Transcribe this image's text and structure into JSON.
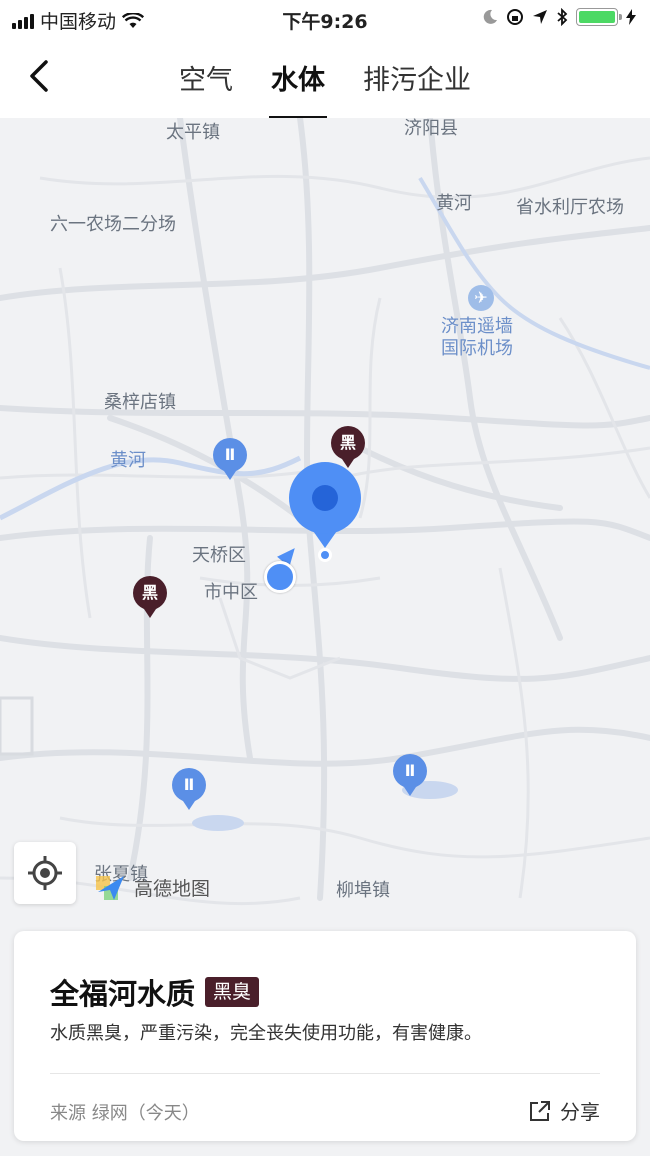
{
  "status_bar": {
    "carrier": "中国移动",
    "time": "下午9:26"
  },
  "nav": {
    "tabs": [
      {
        "label": "空气",
        "active": false
      },
      {
        "label": "水体",
        "active": true
      },
      {
        "label": "排污企业",
        "active": false
      }
    ]
  },
  "map": {
    "labels": {
      "taiping": "太平镇",
      "jiyang": "济阳县",
      "liuyi": "六一农场二分场",
      "huanghe_ne": "黄河",
      "shengshuili": "省水利厅农场",
      "airport_line1": "济南遥墙",
      "airport_line2": "国际机场",
      "sangzidian": "桑梓店镇",
      "huanghe_w": "黄河",
      "tianqiao": "天桥区",
      "shizhong": "市中区",
      "zhangxia": "张夏镇",
      "liubu": "柳埠镇"
    },
    "marker_black_label": "黑",
    "marker_blue_label": "Ⅱ",
    "attribution": "高德地图"
  },
  "card": {
    "title": "全福河水质",
    "badge": "黑臭",
    "description": "水质黑臭，严重污染，完全丧失使用功能，有害健康。",
    "source": "来源 绿网（今天）",
    "share_label": "分享"
  },
  "colors": {
    "black_marker": "#4a1f2a",
    "blue_marker": "#5b8fe6",
    "location": "#4f8ff5"
  }
}
